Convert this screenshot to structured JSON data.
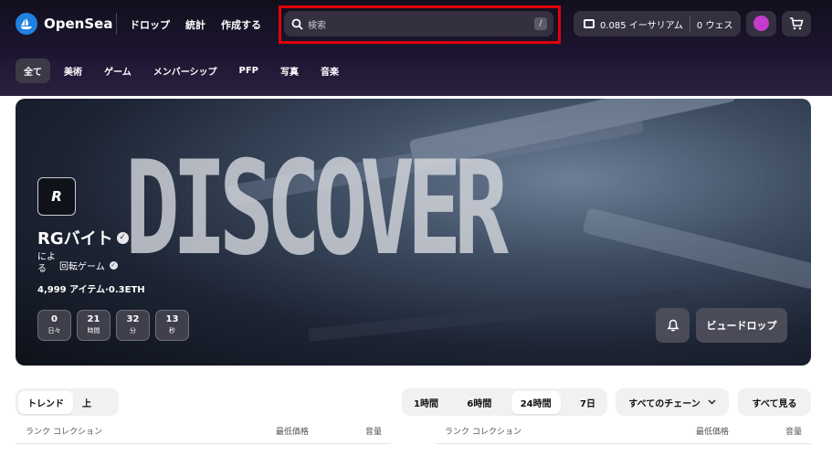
{
  "nav": {
    "logo_text": "OpenSea",
    "links": [
      "ドロップ",
      "統計",
      "作成する"
    ],
    "search_placeholder": "検索",
    "search_shortcut": "/",
    "wallet_eth": "0.085 イーサリアム",
    "wallet_weth": "0 ウェス"
  },
  "categories": [
    "全て",
    "美術",
    "ゲーム",
    "メンバーシップ",
    "PFP",
    "写真",
    "音楽"
  ],
  "hero": {
    "banner_text": "DISCOVER",
    "logo_text": "R",
    "collection_name": "RGバイト",
    "by_label": "による",
    "creator": "回転ゲーム",
    "meta": "4,999 アイテム·0.3ETH",
    "countdown": [
      {
        "value": "0",
        "unit": "日々"
      },
      {
        "value": "21",
        "unit": "時間"
      },
      {
        "value": "32",
        "unit": "分"
      },
      {
        "value": "13",
        "unit": "秒"
      }
    ],
    "view_drop_label": "ビュードロップ"
  },
  "tabs": {
    "trend_label": "トレンド",
    "top_label": "上",
    "time_ranges": [
      "1時間",
      "6時間",
      "24時間",
      "7日"
    ],
    "chain_label": "すべてのチェーン",
    "view_all_label": "すべて見る"
  },
  "table_headers": {
    "rank": "ランク",
    "collection": "コレクション",
    "floor": "最低価格",
    "volume": "音量"
  }
}
